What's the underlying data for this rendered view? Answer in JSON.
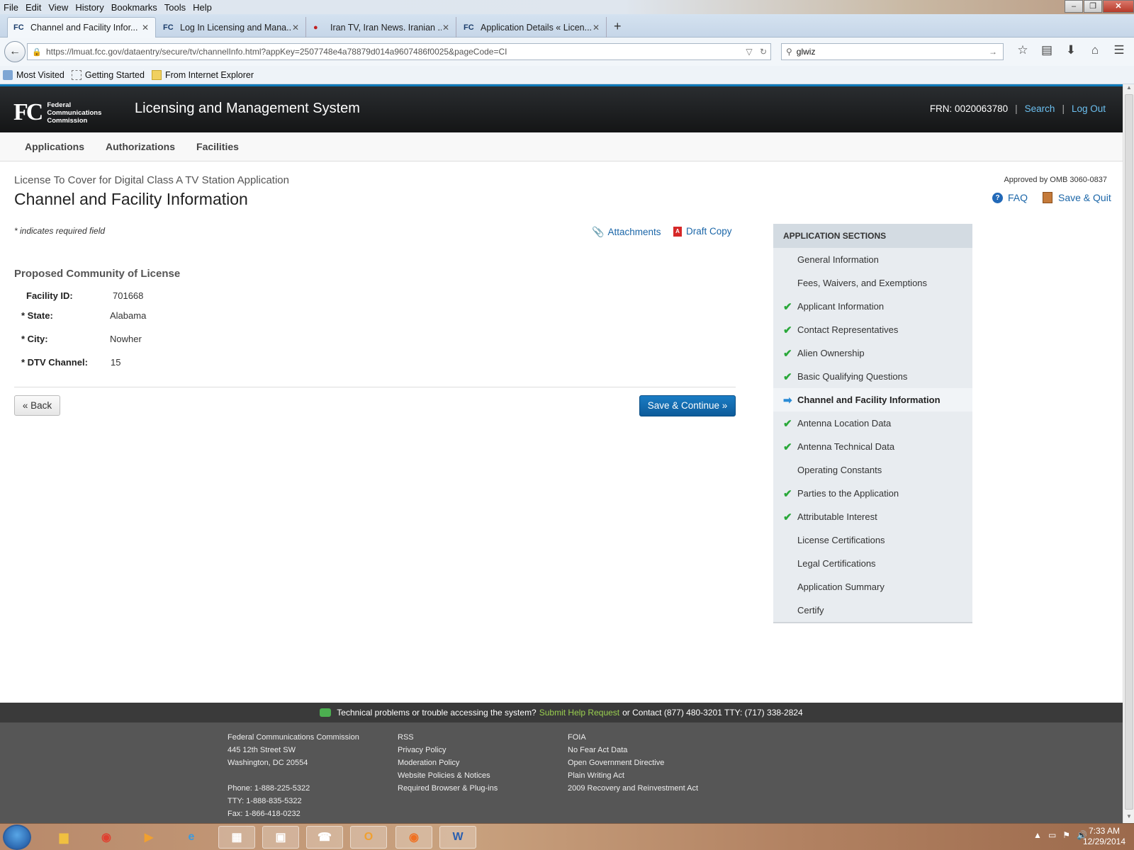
{
  "browser": {
    "menu": [
      "File",
      "Edit",
      "View",
      "History",
      "Bookmarks",
      "Tools",
      "Help"
    ],
    "tabs": [
      {
        "icon": "FC",
        "title": "Channel and Facility Infor..."
      },
      {
        "icon": "FC",
        "title": "Log In Licensing and Mana..."
      },
      {
        "icon": "●",
        "title": "Iran TV, Iran News. Iranian ..."
      },
      {
        "icon": "FC",
        "title": "Application Details « Licen..."
      }
    ],
    "url": "https://lmuat.fcc.gov/dataentry/secure/tv/channelInfo.html?appKey=2507748e4a78879d014a9607486f0025&pageCode=CI",
    "search_value": "glwiz",
    "bookmarks": [
      "Most Visited",
      "Getting Started",
      "From Internet Explorer"
    ]
  },
  "header": {
    "logo_mark": "FC",
    "logo_org": [
      "Federal",
      "Communications",
      "Commission"
    ],
    "title": "Licensing and Management System",
    "frn": "FRN: 0020063780",
    "search_link": "Search",
    "logout_link": "Log Out"
  },
  "subnav": [
    "Applications",
    "Authorizations",
    "Facilities"
  ],
  "page": {
    "app_type": "License To Cover for Digital Class A TV Station Application",
    "title": "Channel and Facility Information",
    "omb": "Approved by OMB 3060-0837",
    "faq": "FAQ",
    "save_quit": "Save & Quit",
    "required_note": "* indicates required field",
    "attachments": "Attachments",
    "draft_copy": "Draft Copy",
    "section_title": "Proposed Community of License",
    "fields": {
      "facility_id": {
        "label": "Facility ID:",
        "value": "701668"
      },
      "state": {
        "label": "* State:",
        "value": "Alabama"
      },
      "city": {
        "label": "* City:",
        "value": "Nowher"
      },
      "dtv_channel": {
        "label": "* DTV Channel:",
        "value": "15"
      }
    },
    "back_button": "« Back",
    "save_continue_button": "Save & Continue »"
  },
  "sidebar": {
    "heading": "APPLICATION SECTIONS",
    "items": [
      {
        "label": "General Information",
        "status": "none"
      },
      {
        "label": "Fees, Waivers, and Exemptions",
        "status": "none"
      },
      {
        "label": "Applicant Information",
        "status": "complete"
      },
      {
        "label": "Contact Representatives",
        "status": "complete"
      },
      {
        "label": "Alien Ownership",
        "status": "complete"
      },
      {
        "label": "Basic Qualifying Questions",
        "status": "complete"
      },
      {
        "label": "Channel and Facility Information",
        "status": "current"
      },
      {
        "label": "Antenna Location Data",
        "status": "complete"
      },
      {
        "label": "Antenna Technical Data",
        "status": "complete"
      },
      {
        "label": "Operating Constants",
        "status": "none"
      },
      {
        "label": "Parties to the Application",
        "status": "complete"
      },
      {
        "label": "Attributable Interest",
        "status": "complete"
      },
      {
        "label": "License Certifications",
        "status": "none"
      },
      {
        "label": "Legal Certifications",
        "status": "none"
      },
      {
        "label": "Application Summary",
        "status": "none"
      },
      {
        "label": "Certify",
        "status": "none"
      }
    ]
  },
  "footer": {
    "help_text": "Technical problems or trouble accessing the system?",
    "help_link": "Submit Help Request",
    "contact": "or Contact (877) 480-3201 TTY: (717) 338-2824",
    "col1": [
      "Federal Communications Commission",
      "445 12th Street SW",
      "Washington, DC 20554",
      "",
      "Phone: 1-888-225-5322",
      "TTY: 1-888-835-5322",
      "Fax: 1-866-418-0232"
    ],
    "col2": [
      "RSS",
      "Privacy Policy",
      "Moderation Policy",
      "Website Policies & Notices",
      "Required Browser & Plug-ins"
    ],
    "col3": [
      "FOIA",
      "No Fear Act Data",
      "Open Government Directive",
      "Plain Writing Act",
      "2009 Recovery and Reinvestment Act"
    ]
  },
  "taskbar": {
    "time": "7:33 AM",
    "date": "12/29/2014"
  },
  "colors": {
    "accent": "#0f7ab9",
    "link": "#1b66a8",
    "check": "#2aa83a",
    "primary_button": "#0d5b9a"
  }
}
